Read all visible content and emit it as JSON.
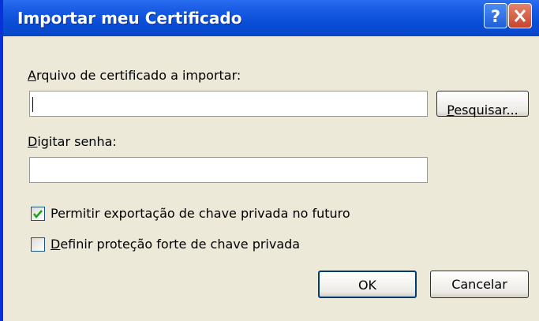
{
  "dialog": {
    "title": "Importar meu Certificado",
    "file_label_first": "A",
    "file_label_rest": "rquivo de certificado a importar:",
    "file_value": "",
    "browse_label_first": "P",
    "browse_label_rest": "esquisar...",
    "password_label_first": "D",
    "password_label_rest": "igitar senha:",
    "password_value": "",
    "checkbox_export_label": "Permitir exportação de chave privada no futuro",
    "checkbox_export_checked": true,
    "checkbox_strong_first": "D",
    "checkbox_strong_rest": "efinir proteção forte de chave privada",
    "checkbox_strong_checked": false,
    "ok_label": "OK",
    "cancel_label": "Cancelar"
  },
  "icons": {
    "help": "help-icon",
    "close": "close-icon",
    "check": "checkmark-icon"
  },
  "colors": {
    "titlebar": "#0A4FD8",
    "dialog_bg": "#ECE9D8",
    "close_button": "#C7452A",
    "check_green": "#21A121"
  }
}
